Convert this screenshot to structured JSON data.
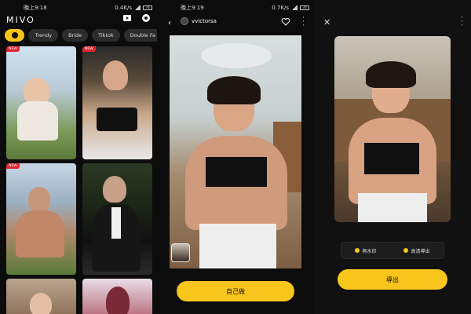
{
  "screen1": {
    "status": {
      "time": "晚上9:18",
      "speed": "0.4K/s",
      "battery": "76"
    },
    "app_name": "MIVO",
    "tabs": [
      "Trendy",
      "Bride",
      "Tiktok",
      "Double Fa"
    ],
    "new_badge": "NEW"
  },
  "screen2": {
    "status": {
      "time": "晚上9:19",
      "speed": "0.7K/s",
      "battery": "76"
    },
    "username": "vvictorsa",
    "do_it_button": "自己做"
  },
  "screen3": {
    "watermark_option": "無水印",
    "hd_option": "高清導出",
    "export_button": "導出"
  },
  "colors": {
    "accent": "#f7c51c",
    "badge": "#e2262f",
    "background": "#0c0c0c"
  }
}
